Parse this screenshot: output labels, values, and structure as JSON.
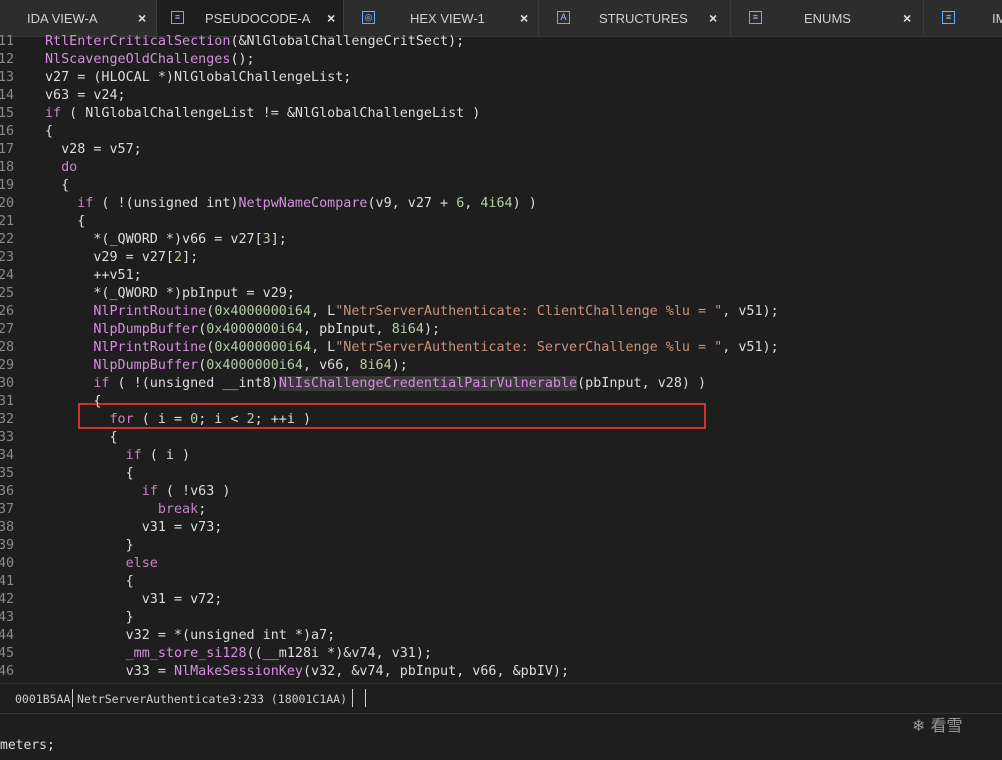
{
  "tabs": [
    {
      "label": "IDA VIEW-A",
      "icon": "",
      "close": "×"
    },
    {
      "label": "PSEUDOCODE-A",
      "icon": "≡",
      "close": "×"
    },
    {
      "label": "HEX VIEW-1",
      "icon": "◎",
      "close": "×"
    },
    {
      "label": "STRUCTURES",
      "icon": "A",
      "close": "×"
    },
    {
      "label": "ENUMS",
      "icon": "≡",
      "close": "×"
    },
    {
      "label": "IM",
      "icon": "≡",
      "close": ""
    }
  ],
  "code_lines": [
    {
      "num": "11",
      "segs": [
        [
          "RtlEnterCriticalSection",
          "fn"
        ],
        [
          "(&NlGlobalChallengeCritSect);",
          ""
        ]
      ]
    },
    {
      "num": "12",
      "segs": [
        [
          "NlScavengeOldChallenges",
          "fn"
        ],
        [
          "();",
          ""
        ]
      ]
    },
    {
      "num": "13",
      "segs": [
        [
          "v27 = (HLOCAL *)NlGlobalChallengeList;",
          ""
        ]
      ]
    },
    {
      "num": "14",
      "segs": [
        [
          "v63 = v24;",
          ""
        ]
      ]
    },
    {
      "num": "15",
      "segs": [
        [
          "if",
          "kw"
        ],
        [
          " ( NlGlobalChallengeList != &NlGlobalChallengeList )",
          ""
        ]
      ]
    },
    {
      "num": "16",
      "segs": [
        [
          "{",
          ""
        ]
      ]
    },
    {
      "num": "17",
      "segs": [
        [
          "  v28 = v57;",
          ""
        ]
      ]
    },
    {
      "num": "18",
      "segs": [
        [
          "  ",
          ""
        ],
        [
          "do",
          "kw"
        ]
      ]
    },
    {
      "num": "19",
      "segs": [
        [
          "  {",
          ""
        ]
      ]
    },
    {
      "num": "20",
      "segs": [
        [
          "    ",
          ""
        ],
        [
          "if",
          "kw"
        ],
        [
          " ( !(unsigned int)",
          ""
        ],
        [
          "NetpwNameCompare",
          "fn"
        ],
        [
          "(v9, v27 + ",
          ""
        ],
        [
          "6",
          "num"
        ],
        [
          ", ",
          ""
        ],
        [
          "4i64",
          "num"
        ],
        [
          ") )",
          ""
        ]
      ]
    },
    {
      "num": "21",
      "segs": [
        [
          "    {",
          ""
        ]
      ]
    },
    {
      "num": "22",
      "segs": [
        [
          "      *(_QWORD *)v66 = v27[",
          ""
        ],
        [
          "3",
          "num"
        ],
        [
          "];",
          ""
        ]
      ]
    },
    {
      "num": "23",
      "segs": [
        [
          "      v29 = v27[",
          ""
        ],
        [
          "2",
          "num"
        ],
        [
          "];",
          ""
        ]
      ]
    },
    {
      "num": "24",
      "segs": [
        [
          "      ++v51;",
          ""
        ]
      ]
    },
    {
      "num": "25",
      "segs": [
        [
          "      *(_QWORD *)pbInput = v29;",
          ""
        ]
      ]
    },
    {
      "num": "26",
      "segs": [
        [
          "      ",
          ""
        ],
        [
          "NlPrintRoutine",
          "fn"
        ],
        [
          "(",
          ""
        ],
        [
          "0x4000000i64",
          "num"
        ],
        [
          ", L",
          ""
        ],
        [
          "\"NetrServerAuthenticate: ClientChallenge %lu = \"",
          "str"
        ],
        [
          ", v51);",
          ""
        ]
      ]
    },
    {
      "num": "27",
      "segs": [
        [
          "      ",
          ""
        ],
        [
          "NlpDumpBuffer",
          "fn"
        ],
        [
          "(",
          ""
        ],
        [
          "0x4000000i64",
          "num"
        ],
        [
          ", pbInput, ",
          ""
        ],
        [
          "8i64",
          "num"
        ],
        [
          ");",
          ""
        ]
      ]
    },
    {
      "num": "28",
      "segs": [
        [
          "      ",
          ""
        ],
        [
          "NlPrintRoutine",
          "fn"
        ],
        [
          "(",
          ""
        ],
        [
          "0x4000000i64",
          "num"
        ],
        [
          ", L",
          ""
        ],
        [
          "\"NetrServerAuthenticate: ServerChallenge %lu = \"",
          "str"
        ],
        [
          ", v51);",
          ""
        ]
      ]
    },
    {
      "num": "29",
      "segs": [
        [
          "      ",
          ""
        ],
        [
          "NlpDumpBuffer",
          "fn"
        ],
        [
          "(",
          ""
        ],
        [
          "0x4000000i64",
          "num"
        ],
        [
          ", v66, ",
          ""
        ],
        [
          "8i64",
          "num"
        ],
        [
          ");",
          ""
        ]
      ]
    },
    {
      "num": "30",
      "segs": [
        [
          "      ",
          ""
        ],
        [
          "if",
          "kw"
        ],
        [
          " ( !(unsigned __int8)",
          ""
        ],
        [
          "NlIsChallengeCredentialPairVulnerable",
          "fn hl"
        ],
        [
          "(pbInput, v28) )",
          ""
        ]
      ]
    },
    {
      "num": "31",
      "segs": [
        [
          "      {",
          ""
        ]
      ]
    },
    {
      "num": "32",
      "segs": [
        [
          "        ",
          ""
        ],
        [
          "for",
          "kw"
        ],
        [
          " ( i = ",
          ""
        ],
        [
          "0",
          "num"
        ],
        [
          "; i < ",
          ""
        ],
        [
          "2",
          "num"
        ],
        [
          "; ++i )",
          ""
        ]
      ]
    },
    {
      "num": "33",
      "segs": [
        [
          "        {",
          ""
        ]
      ]
    },
    {
      "num": "34",
      "segs": [
        [
          "          ",
          ""
        ],
        [
          "if",
          "kw"
        ],
        [
          " ( i )",
          ""
        ]
      ]
    },
    {
      "num": "35",
      "segs": [
        [
          "          {",
          ""
        ]
      ]
    },
    {
      "num": "36",
      "segs": [
        [
          "            ",
          ""
        ],
        [
          "if",
          "kw"
        ],
        [
          " ( !v63 )",
          ""
        ]
      ]
    },
    {
      "num": "37",
      "segs": [
        [
          "              ",
          ""
        ],
        [
          "break",
          "kw"
        ],
        [
          ";",
          ""
        ]
      ]
    },
    {
      "num": "38",
      "segs": [
        [
          "            v31 = v73;",
          ""
        ]
      ]
    },
    {
      "num": "39",
      "segs": [
        [
          "          }",
          ""
        ]
      ]
    },
    {
      "num": "40",
      "segs": [
        [
          "          ",
          ""
        ],
        [
          "else",
          "kw"
        ]
      ]
    },
    {
      "num": "41",
      "segs": [
        [
          "          {",
          ""
        ]
      ]
    },
    {
      "num": "42",
      "segs": [
        [
          "            v31 = v72;",
          ""
        ]
      ]
    },
    {
      "num": "43",
      "segs": [
        [
          "          }",
          ""
        ]
      ]
    },
    {
      "num": "44",
      "segs": [
        [
          "          v32 = *(unsigned int *)a7;",
          ""
        ]
      ]
    },
    {
      "num": "45",
      "segs": [
        [
          "          ",
          ""
        ],
        [
          "_mm_store_si128",
          "fn"
        ],
        [
          "((__m128i *)&v74, v31);",
          ""
        ]
      ]
    },
    {
      "num": "46",
      "segs": [
        [
          "          v33 = ",
          ""
        ],
        [
          "NlMakeSessionKey",
          "fn"
        ],
        [
          "(v32, &v74, pbInput, v66, &pbIV);",
          ""
        ]
      ]
    }
  ],
  "status": {
    "address": "0001B5AA",
    "function": "NetrServerAuthenticate3:233 (18001C1AA)"
  },
  "output": {
    "line1": "meters;"
  },
  "watermark": "看雪",
  "colors": {
    "keyword": "#c586c0",
    "function": "#d68ee0",
    "number": "#b5cea8",
    "string": "#ce9178",
    "highlight_box": "#d0312d"
  }
}
